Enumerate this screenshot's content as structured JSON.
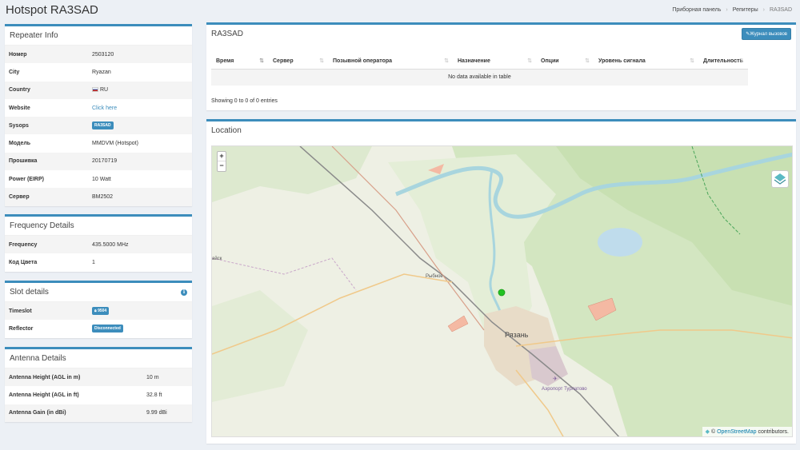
{
  "page": {
    "title": "Hotspot RA3SAD"
  },
  "breadcrumb": {
    "items": [
      "Приборная панель",
      "Репитеры",
      "RA3SAD"
    ]
  },
  "repeater_info": {
    "title": "Repeater Info",
    "rows": [
      {
        "label": "Номер",
        "value": "2503120"
      },
      {
        "label": "City",
        "value": "Ryazan"
      },
      {
        "label": "Country",
        "value": "RU"
      },
      {
        "label": "Website",
        "value": "Click here"
      },
      {
        "label": "Sysops",
        "value": "RA3SAD"
      },
      {
        "label": "Модель",
        "value": "MMDVM (Hotspot)"
      },
      {
        "label": "Прошивка",
        "value": "20170719"
      },
      {
        "label": "Power (EIRP)",
        "value": "10 Watt"
      },
      {
        "label": "Сервер",
        "value": "BM2502"
      }
    ]
  },
  "frequency": {
    "title": "Frequency Details",
    "rows": [
      {
        "label": "Frequency",
        "value": "435.5000 MHz"
      },
      {
        "label": "Код Цвета",
        "value": "1"
      }
    ]
  },
  "slot": {
    "title": "Slot details",
    "rows": [
      {
        "label": "Timeslot",
        "value": "9504"
      },
      {
        "label": "Reflector",
        "value": "Disconnected"
      }
    ]
  },
  "antenna": {
    "title": "Antenna Details",
    "rows": [
      {
        "label": "Antenna Height (AGL in m)",
        "value": "10 m"
      },
      {
        "label": "Antenna Height (AGL in ft)",
        "value": "32.8 ft"
      },
      {
        "label": "Antenna Gain (in dBi)",
        "value": "9.99 dBi"
      }
    ]
  },
  "calls": {
    "title": "RA3SAD",
    "button": "Журнал вызовов",
    "columns": [
      "Время",
      "Сервер",
      "Позывной оператора",
      "Назначение",
      "Опции",
      "Уровень сигнала",
      "Длительность"
    ],
    "empty": "No data available in table",
    "info": "Showing 0 to 0 of 0 entries"
  },
  "location": {
    "title": "Location",
    "zoom_in": "+",
    "zoom_out": "−",
    "labels": {
      "city": "Рязань",
      "town": "Рыбное",
      "airport": "Аэропорт Турлатово",
      "edge": "айск"
    },
    "attribution_prefix": "©",
    "attribution_link": "OpenStreetMap",
    "attribution_suffix": "contributors."
  },
  "colors": {
    "accent": "#3c8dbc",
    "marker": "#22c222",
    "river": "#a8d5de",
    "forest": "#c7dfb0"
  }
}
